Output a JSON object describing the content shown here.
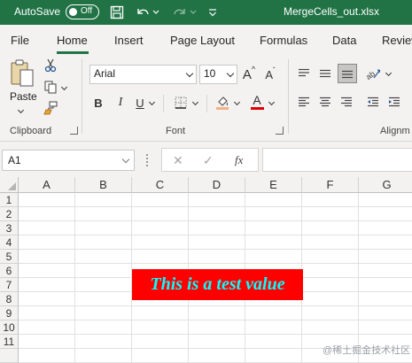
{
  "titlebar": {
    "autosave_label": "AutoSave",
    "autosave_state": "Off",
    "file_name": "MergeCells_out.xlsx",
    "accent_color": "#217346"
  },
  "ribbon_tabs": [
    "File",
    "Home",
    "Insert",
    "Page Layout",
    "Formulas",
    "Data",
    "Review"
  ],
  "active_tab": "Home",
  "clipboard": {
    "paste_label": "Paste",
    "group_label": "Clipboard"
  },
  "font": {
    "name": "Arial",
    "size": "10",
    "bold": "B",
    "italic": "I",
    "underline": "U",
    "font_color_glyph": "A",
    "grow_glyph": "A",
    "shrink_glyph": "A",
    "group_label": "Font"
  },
  "alignment": {
    "group_label": "Alignm"
  },
  "formula_bar": {
    "name_box": "A1",
    "fx_label": "fx",
    "formula": ""
  },
  "columns": [
    "A",
    "B",
    "C",
    "D",
    "E",
    "F",
    "G"
  ],
  "rows": [
    "1",
    "2",
    "3",
    "4",
    "5",
    "6",
    "7",
    "8",
    "9",
    "10",
    "11"
  ],
  "merged_cell": {
    "text": "This is a test value",
    "fill_color": "#ff0000",
    "text_color": "#00ffff"
  },
  "watermark": "@稀土掘金技术社区"
}
